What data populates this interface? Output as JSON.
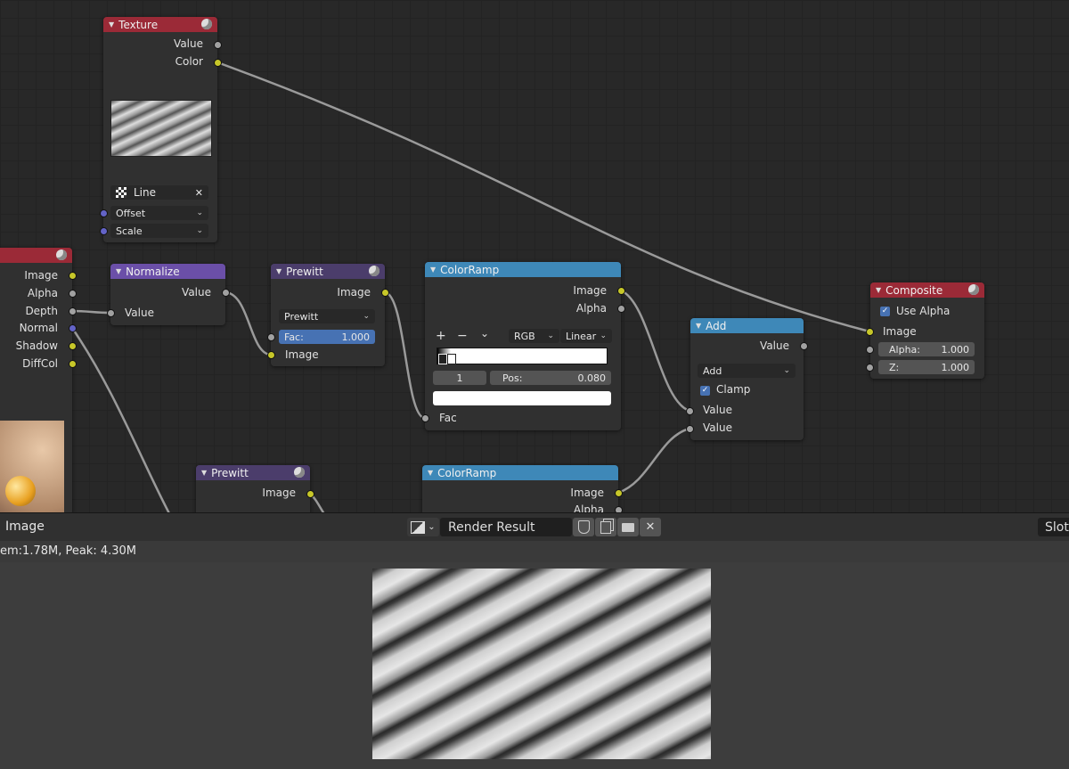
{
  "node_editor": {
    "nodes": {
      "texture": {
        "title": "Texture",
        "out_value": "Value",
        "out_color": "Color",
        "texture_name": "Line",
        "offset_label": "Offset",
        "scale_label": "Scale"
      },
      "render_layers": {
        "out_image": "Image",
        "out_alpha": "Alpha",
        "out_depth": "Depth",
        "out_normal": "Normal",
        "out_shadow": "Shadow",
        "out_diffcol": "DiffCol"
      },
      "normalize": {
        "title": "Normalize",
        "out_value": "Value",
        "in_value": "Value"
      },
      "prewitt1": {
        "title": "Prewitt",
        "out_image": "Image",
        "filter_type": "Prewitt",
        "fac_label": "Fac:",
        "fac_value": "1.000",
        "in_image": "Image"
      },
      "colorramp1": {
        "title": "ColorRamp",
        "out_image": "Image",
        "out_alpha": "Alpha",
        "add_sym": "+",
        "remove_sym": "−",
        "menu_sym": "⌄",
        "color_mode": "RGB",
        "interpolation": "Linear",
        "stop_index": "1",
        "pos_label": "Pos:",
        "pos_value": "0.080",
        "in_fac": "Fac"
      },
      "add": {
        "title": "Add",
        "out_value": "Value",
        "operation": "Add",
        "clamp_label": "Clamp",
        "in_value1": "Value",
        "in_value2": "Value"
      },
      "composite": {
        "title": "Composite",
        "use_alpha_label": "Use Alpha",
        "in_image": "Image",
        "alpha_label": "Alpha:",
        "alpha_value": "1.000",
        "z_label": "Z:",
        "z_value": "1.000"
      },
      "prewitt2": {
        "title": "Prewitt",
        "out_image": "Image"
      },
      "colorramp2": {
        "title": "ColorRamp",
        "out_image": "Image",
        "out_alpha": "Alpha"
      }
    }
  },
  "image_editor": {
    "header_title": "Image",
    "image_name": "Render Result",
    "slot_label": "Slot",
    "status": "em:1.78M, Peak: 4.30M"
  }
}
